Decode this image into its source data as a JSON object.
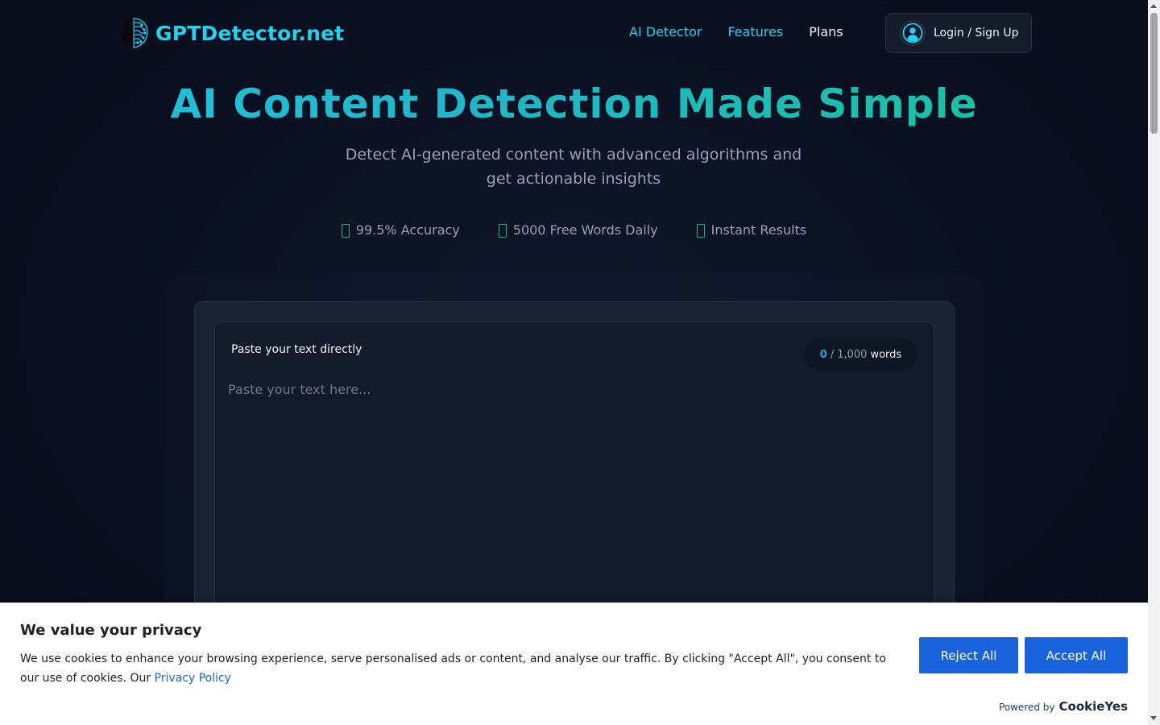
{
  "header": {
    "logo_text": "GPTDetector.net",
    "nav": [
      {
        "label": "AI Detector"
      },
      {
        "label": "Features"
      },
      {
        "label": "Plans"
      }
    ],
    "login_label": "Login / Sign Up"
  },
  "hero": {
    "title": "AI Content Detection Made Simple",
    "subtitle": "Detect AI-generated content with advanced algorithms and get actionable insights",
    "features": [
      {
        "icon": "check-icon",
        "label": "99.5% Accuracy"
      },
      {
        "icon": "gift-icon",
        "label": "5000 Free Words Daily"
      },
      {
        "icon": "bolt-icon",
        "label": "Instant Results"
      }
    ]
  },
  "editor": {
    "label": "Paste your text directly",
    "word_count": {
      "current": "0",
      "separator": "/",
      "max": "1,000",
      "unit": "words"
    },
    "value": "",
    "placeholder": "Paste your text here..."
  },
  "cookie_banner": {
    "title": "We value your privacy",
    "text": "We use cookies to enhance your browsing experience, serve personalised ads or content, and analyse our traffic. By clicking \"Accept All\", you consent to our use of cookies. Our ",
    "policy_link": "Privacy Policy",
    "reject_label": "Reject All",
    "accept_label": "Accept All",
    "powered_by": "Powered by",
    "brand": "CookieYes"
  },
  "colors": {
    "accent": "#22d3ee",
    "green": "#10b981",
    "button_blue": "#1863dc",
    "background": "#0b1120"
  }
}
